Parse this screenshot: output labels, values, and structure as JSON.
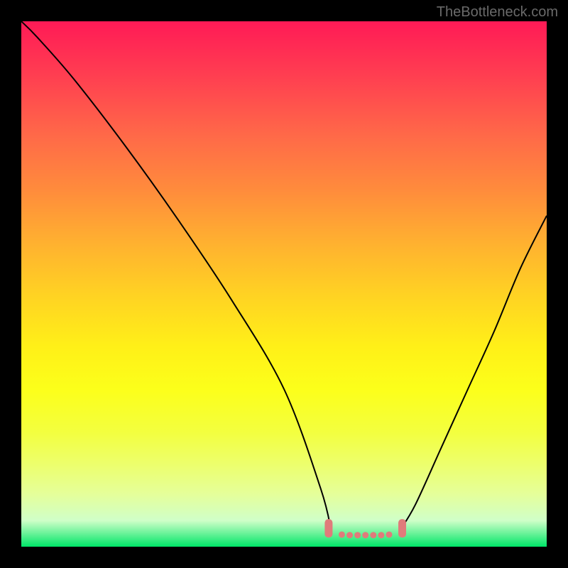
{
  "watermark": "TheBottleneck.com",
  "chart_data": {
    "type": "line",
    "title": "",
    "xlabel": "",
    "ylabel": "",
    "description": "Bottleneck curve on heat-gradient background; V-shaped curve with flat valley; pink markers at valley ends.",
    "x_range": [
      0,
      100
    ],
    "y_range": [
      0,
      100
    ],
    "series": [
      {
        "name": "left-curve",
        "x": [
          0,
          3,
          10,
          20,
          30,
          40,
          50,
          57,
          59
        ],
        "y": [
          100,
          97,
          89,
          76,
          62,
          47,
          30,
          11,
          3
        ]
      },
      {
        "name": "valley-floor",
        "x": [
          59,
          62,
          66,
          69,
          72
        ],
        "y": [
          3,
          2.5,
          2.5,
          2.5,
          3
        ]
      },
      {
        "name": "right-curve",
        "x": [
          72,
          75,
          80,
          85,
          90,
          95,
          100
        ],
        "y": [
          3,
          8,
          19,
          30,
          41,
          53,
          63
        ]
      }
    ],
    "markers": [
      {
        "name": "valley-left-marker",
        "x": 58.5,
        "y": 3.5,
        "color": "#e07b7b"
      },
      {
        "name": "valley-right-marker",
        "x": 72.5,
        "y": 3.5,
        "color": "#e07b7b"
      }
    ],
    "valley_dots": {
      "color": "#e07b7b",
      "points": [
        {
          "x": 61,
          "y": 2.3
        },
        {
          "x": 62.5,
          "y": 2.2
        },
        {
          "x": 64,
          "y": 2.2
        },
        {
          "x": 65.5,
          "y": 2.2
        },
        {
          "x": 67,
          "y": 2.2
        },
        {
          "x": 68.5,
          "y": 2.2
        },
        {
          "x": 70,
          "y": 2.3
        }
      ]
    }
  }
}
